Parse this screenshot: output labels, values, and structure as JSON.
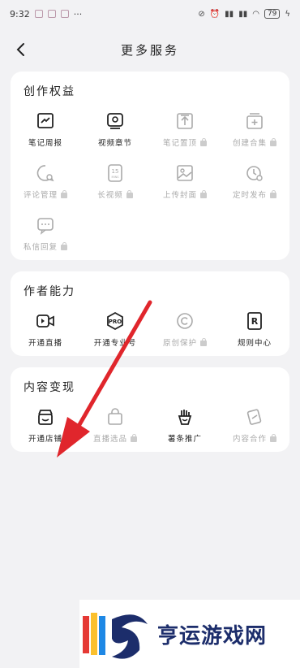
{
  "status": {
    "time": "9:32",
    "dots": "···",
    "battery": "79"
  },
  "header": {
    "title": "更多服务"
  },
  "sections": [
    {
      "title": "创作权益",
      "items": [
        {
          "label": "笔记周报",
          "icon": "report-icon",
          "locked": false
        },
        {
          "label": "视频章节",
          "icon": "video-chapter-icon",
          "locked": false
        },
        {
          "label": "笔记置顶",
          "icon": "pin-icon",
          "locked": true
        },
        {
          "label": "创建合集",
          "icon": "collection-icon",
          "locked": true
        },
        {
          "label": "评论管理",
          "icon": "comment-icon",
          "locked": true
        },
        {
          "label": "长视频",
          "icon": "long-video-icon",
          "locked": true
        },
        {
          "label": "上传封面",
          "icon": "cover-icon",
          "locked": true
        },
        {
          "label": "定时发布",
          "icon": "timer-icon",
          "locked": true
        },
        {
          "label": "私信回复",
          "icon": "message-icon",
          "locked": true
        }
      ]
    },
    {
      "title": "作者能力",
      "items": [
        {
          "label": "开通直播",
          "icon": "live-icon",
          "locked": false
        },
        {
          "label": "开通专业号",
          "icon": "pro-icon",
          "locked": false
        },
        {
          "label": "原创保护",
          "icon": "copyright-icon",
          "locked": true
        },
        {
          "label": "规则中心",
          "icon": "rules-icon",
          "locked": false
        }
      ]
    },
    {
      "title": "内容变现",
      "items": [
        {
          "label": "开通店铺",
          "icon": "shop-icon",
          "locked": false
        },
        {
          "label": "直播选品",
          "icon": "bag-icon",
          "locked": true
        },
        {
          "label": "薯条推广",
          "icon": "fries-icon",
          "locked": false
        },
        {
          "label": "内容合作",
          "icon": "cooperation-icon",
          "locked": true
        }
      ]
    }
  ],
  "watermark": {
    "text": "亨运游戏网"
  }
}
